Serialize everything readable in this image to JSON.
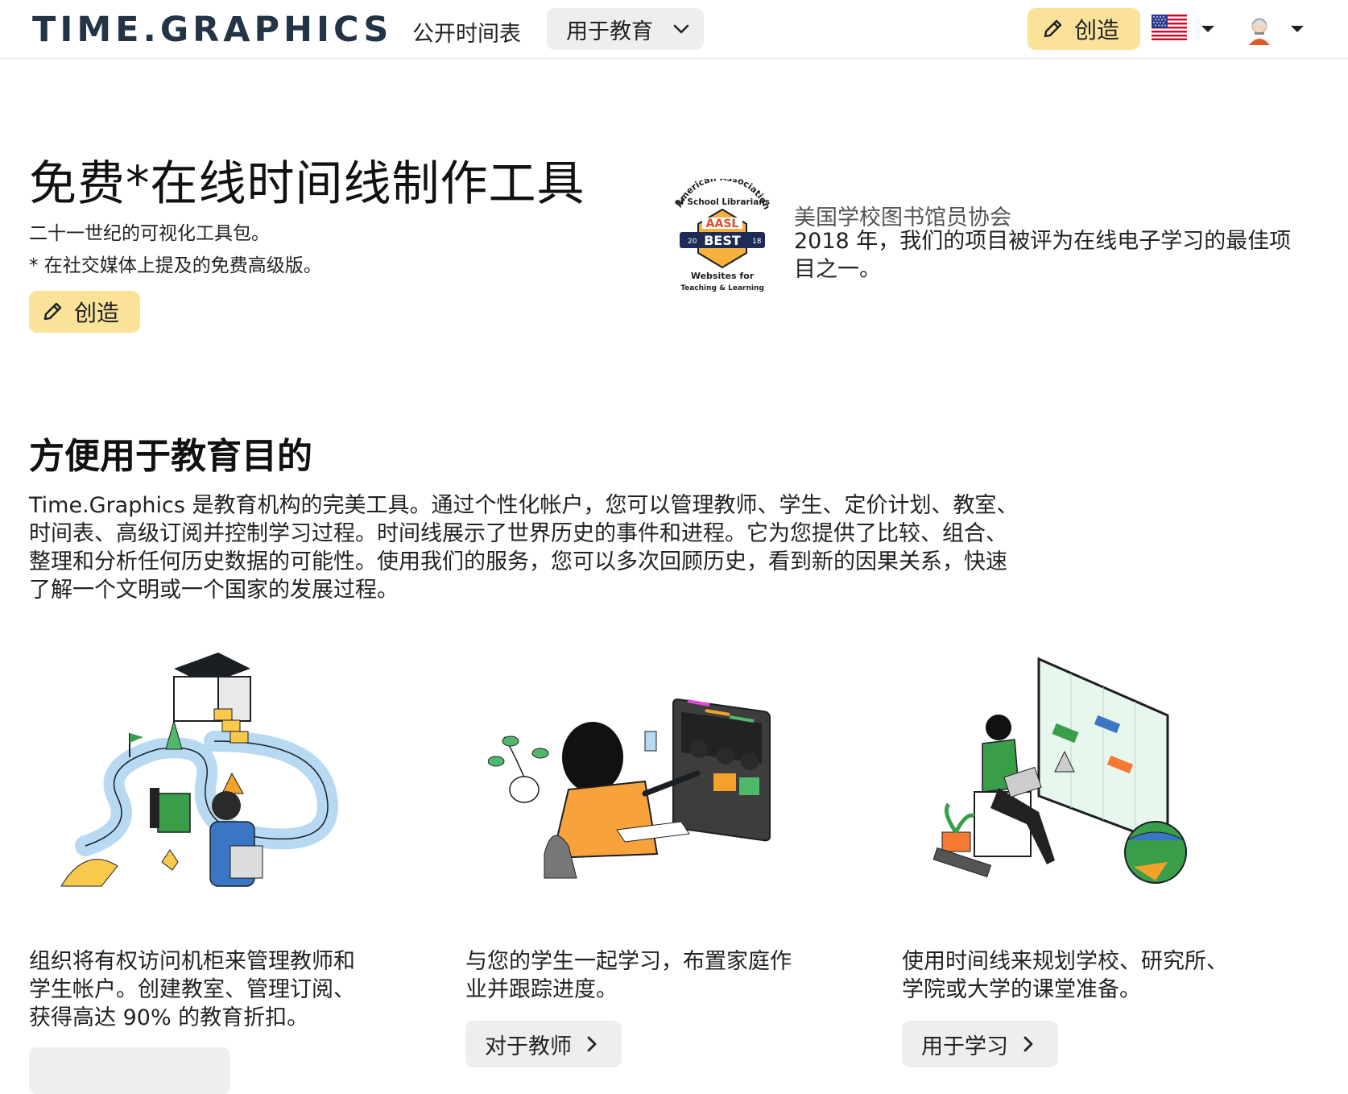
{
  "header": {
    "logo": "TIME.GRAPHICS",
    "nav_public": "公开时间表",
    "nav_education": "用于教育",
    "create_label": "创造"
  },
  "hero": {
    "title": "免费*在线时间线制作工具",
    "subtitle1": "二十一世纪的可视化工具包。",
    "subtitle2": "* 在社交媒体上提及的免费高级版。",
    "create_label": "创造"
  },
  "award": {
    "badge_line1": "American Association",
    "badge_line2": "of School Librarians",
    "badge_aasl": "AASL",
    "badge_best": "BEST",
    "badge_year_left": "20",
    "badge_year_right": "18",
    "badge_bottom1": "Websites for",
    "badge_bottom2": "Teaching & Learning",
    "org": "美国学校图书馆员协会",
    "description": "2018 年，我们的项目被评为在线电子学习的最佳项目之一。"
  },
  "education": {
    "title": "方便用于教育目的",
    "paragraph": "Time.Graphics 是教育机构的完美工具。通过个性化帐户，您可以管理教师、学生、定价计划、教室、时间表、高级订阅并控制学习过程。时间线展示了世界历史的事件和进程。它为您提供了比较、组合、整理和分析任何历史数据的可能性。使用我们的服务，您可以多次回顾历史，看到新的因果关系，快速了解一个文明或一个国家的发展过程。",
    "cards": [
      {
        "text": "组织将有权访问机柜来管理教师和学生帐户。创建教室、管理订阅、获得高达 90% 的教育折扣。",
        "button": ""
      },
      {
        "text": "与您的学生一起学习，布置家庭作业并跟踪进度。",
        "button": "对于教师"
      },
      {
        "text": "使用时间线来规划学校、研究所、学院或大学的课堂准备。",
        "button": "用于学习"
      }
    ]
  },
  "colors": {
    "accent_yellow": "#fbe29a",
    "logo": "#243447",
    "button_grey": "#eceef0"
  },
  "icons": [
    "pencil-icon",
    "chevron-down-icon",
    "us-flag-icon",
    "caret-down-icon",
    "user-avatar-icon",
    "chevron-right-icon"
  ]
}
